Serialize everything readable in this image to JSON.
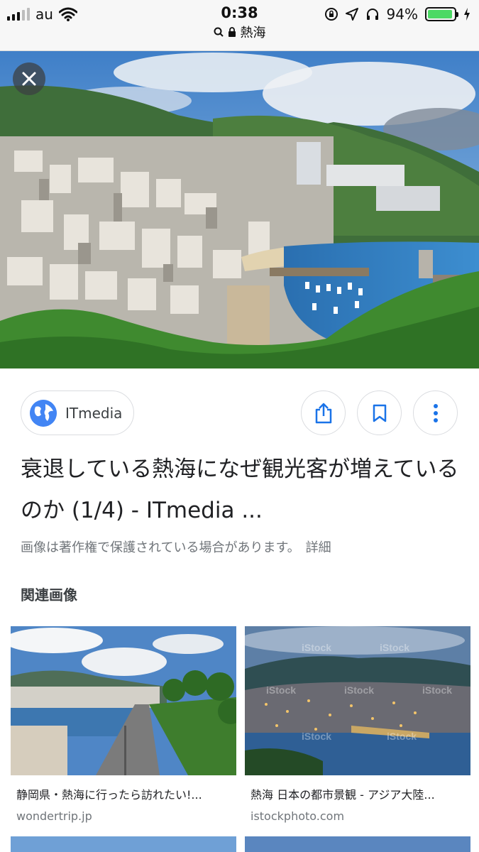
{
  "status_bar": {
    "carrier": "au",
    "time": "0:38",
    "url": "熱海",
    "battery_percent": "94%",
    "battery_level": 0.94,
    "icons": [
      "signal-icon",
      "wifi-icon",
      "search-icon",
      "lock-icon",
      "orientation-lock-icon",
      "location-icon",
      "headphones-icon",
      "battery-icon",
      "charging-icon"
    ]
  },
  "viewer": {
    "close_icon": "close-icon",
    "source": {
      "name": "ITmedia",
      "icon": "globe-icon"
    },
    "actions": [
      "share-icon",
      "bookmark-icon",
      "more-vert-icon"
    ],
    "title": "衰退している熱海になぜ観光客が増えているのか (1/4) - ITmedia ...",
    "copyright_notice": "画像は著作権で保護されている場合があります。",
    "detail_link": "詳細"
  },
  "related": {
    "heading": "関連画像",
    "items": [
      {
        "title": "静岡県・熱海に行ったら訪れたい!...",
        "source": "wondertrip.jp"
      },
      {
        "title": "熱海 日本の都市景観 - アジア大陸...",
        "source": "istockphoto.com"
      }
    ]
  },
  "colors": {
    "accent": "#1a73e8",
    "brand_blue": "#4285f4",
    "border": "#dadce0",
    "muted": "#70757a"
  }
}
